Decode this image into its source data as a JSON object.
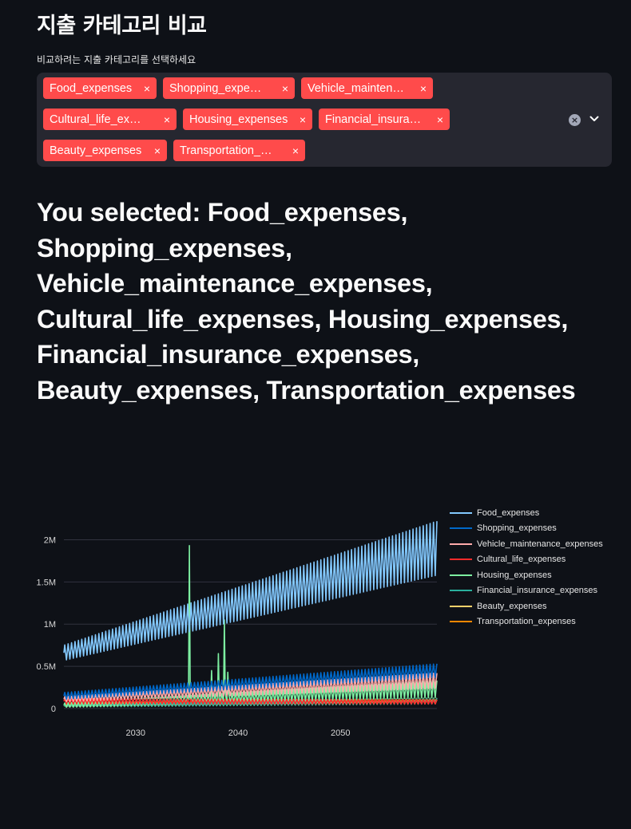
{
  "header": {
    "title": "지출 카테고리 비교",
    "select_label": "비교하려는 지출 카테고리를 선택하세요"
  },
  "multiselect": {
    "chip_rows": [
      [
        {
          "label": "Food_expenses",
          "width": 142
        },
        {
          "label": "Shopping_expe…",
          "width": 165
        },
        {
          "label": "Vehicle_mainten…",
          "width": 165
        }
      ],
      [
        {
          "label": "Cultural_life_ex…",
          "width": 167
        },
        {
          "label": "Housing_expenses",
          "width": 162
        },
        {
          "label": "Financial_insura…",
          "width": 164
        }
      ],
      [
        {
          "label": "Beauty_expenses",
          "width": 155
        },
        {
          "label": "Transportation_…",
          "width": 165
        }
      ]
    ],
    "remove_glyph": "×",
    "clear_glyph": "×"
  },
  "selected_heading": "You selected: Food_expenses, Shopping_expenses, Vehicle_maintenance_expenses, Cultural_life_expenses, Housing_expenses, Financial_insurance_expenses, Beauty_expenses, Transportation_expenses",
  "chart_data": {
    "type": "line",
    "x_type": "date",
    "xlim": [
      "2023-01",
      "2059-06"
    ],
    "x_ticks": [
      "2030",
      "2040",
      "2050"
    ],
    "ylim": [
      0,
      2250000
    ],
    "y_ticks": [
      {
        "value": 0,
        "label": "0"
      },
      {
        "value": 500000,
        "label": "0.5M"
      },
      {
        "value": 1000000,
        "label": "1M"
      },
      {
        "value": 1500000,
        "label": "1.5M"
      },
      {
        "value": 2000000,
        "label": "2M"
      }
    ],
    "grid": "horizontal",
    "legend": "right",
    "series": [
      {
        "name": "Food_expenses",
        "color": "#83c9ff",
        "start": 660000,
        "end": 1900000,
        "amp_start": 90000,
        "amp_end": 320000
      },
      {
        "name": "Shopping_expenses",
        "color": "#0068c9",
        "start": 150000,
        "end": 450000,
        "amp_start": 40000,
        "amp_end": 80000
      },
      {
        "name": "Vehicle_maintenance_expenses",
        "color": "#ffabab",
        "start": 110000,
        "end": 330000,
        "amp_start": 30000,
        "amp_end": 90000
      },
      {
        "name": "Cultural_life_expenses",
        "color": "#ff2b2b",
        "start": 85000,
        "end": 80000,
        "amp_start": 30000,
        "amp_end": 25000
      },
      {
        "name": "Housing_expenses",
        "color": "#7defa1",
        "start": 40000,
        "end": 230000,
        "amp_start": 25000,
        "amp_end": 100000,
        "spikes": [
          {
            "x": "2035-04",
            "y": 1930000
          },
          {
            "x": "2037-06",
            "y": 450000
          },
          {
            "x": "2038-02",
            "y": 650000
          },
          {
            "x": "2038-09",
            "y": 1050000
          },
          {
            "x": "2039-01",
            "y": 430000
          }
        ]
      },
      {
        "name": "Financial_insurance_expenses",
        "color": "#29b09d",
        "start": 30000,
        "end": 90000,
        "amp_start": 12000,
        "amp_end": 35000
      },
      {
        "name": "Beauty_expenses",
        "color": "#ffd16a",
        "start": 28000,
        "end": 80000,
        "amp_start": 10000,
        "amp_end": 25000
      },
      {
        "name": "Transportation_expenses",
        "color": "#ff8700",
        "start": 45000,
        "end": 105000,
        "amp_start": 10000,
        "amp_end": 20000
      }
    ]
  }
}
